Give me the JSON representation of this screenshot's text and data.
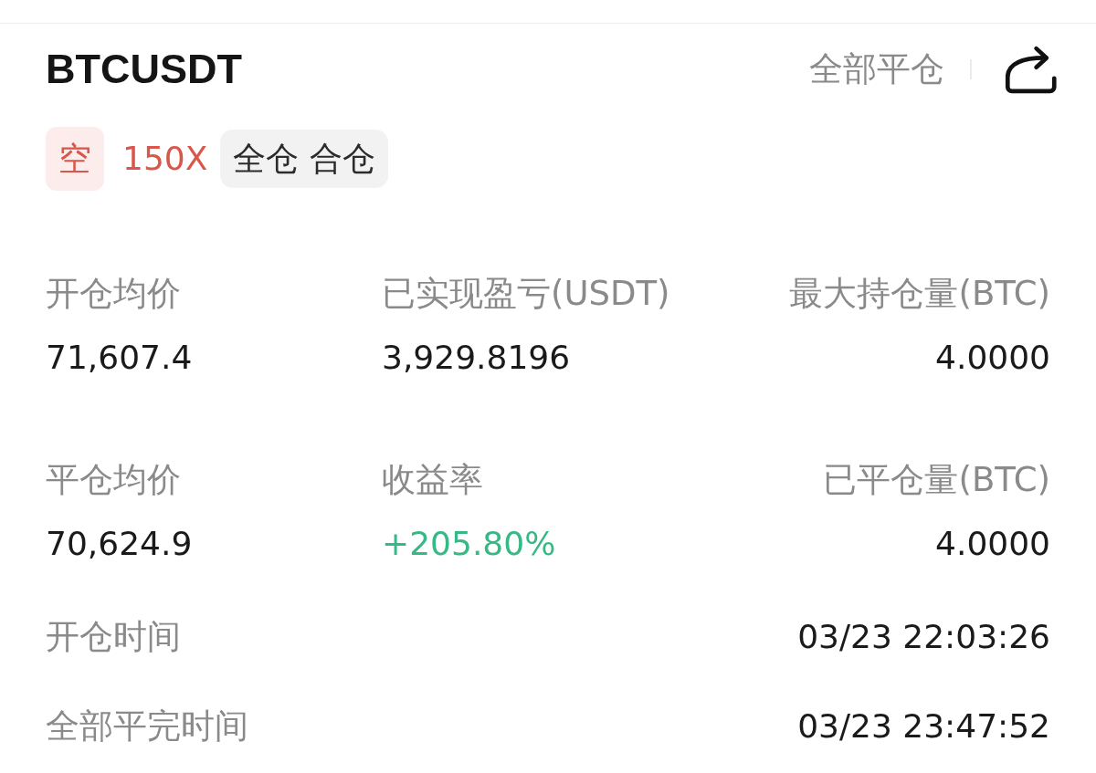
{
  "header": {
    "symbol": "BTCUSDT",
    "close_all": "全部平仓"
  },
  "tags": [
    {
      "kind": "side",
      "text": "空"
    },
    {
      "kind": "leverage",
      "text": "150X"
    },
    {
      "kind": "mode",
      "text": "全仓 合仓"
    }
  ],
  "stats": [
    {
      "label": "开仓均价",
      "value": "71,607.4",
      "kind": "plain"
    },
    {
      "label": "已实现盈亏(USDT)",
      "value": "3,929.8196",
      "kind": "plain"
    },
    {
      "label": "最大持仓量(BTC)",
      "value": "4.0000",
      "kind": "plain"
    },
    {
      "label": "平仓均价",
      "value": "70,624.9",
      "kind": "plain"
    },
    {
      "label": "收益率",
      "value": "+205.80%",
      "kind": "gain"
    },
    {
      "label": "已平仓量(BTC)",
      "value": "4.0000",
      "kind": "plain"
    }
  ],
  "times": [
    {
      "label": "开仓时间",
      "value": "03/23 22:03:26"
    },
    {
      "label": "全部平完时间",
      "value": "03/23 23:47:52"
    }
  ]
}
